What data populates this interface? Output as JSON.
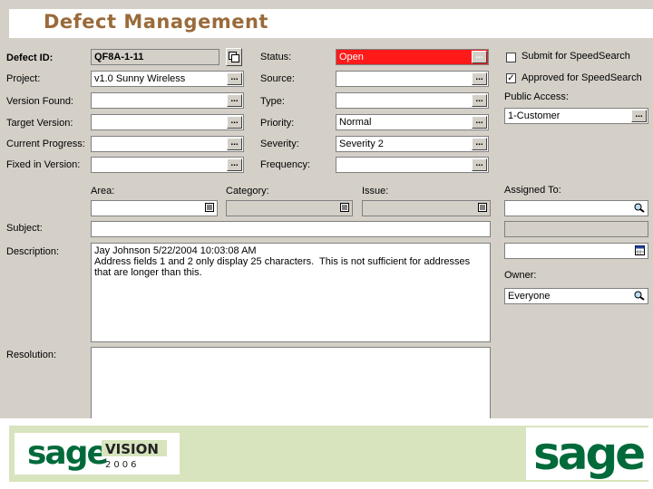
{
  "header": {
    "title": "Defect Management"
  },
  "fields": {
    "defect_id": {
      "label": "Defect ID:",
      "value": "QF8A-1-11"
    },
    "project": {
      "label": "Project:",
      "value": "v1.0 Sunny Wireless"
    },
    "version_found": {
      "label": "Version Found:",
      "value": ""
    },
    "target_version": {
      "label": "Target Version:",
      "value": ""
    },
    "current_progress": {
      "label": "Current Progress:",
      "value": ""
    },
    "fixed_in_version": {
      "label": "Fixed in Version:",
      "value": ""
    },
    "status": {
      "label": "Status:",
      "value": "Open"
    },
    "source": {
      "label": "Source:",
      "value": ""
    },
    "type": {
      "label": "Type:",
      "value": ""
    },
    "priority": {
      "label": "Priority:",
      "value": "Normal"
    },
    "severity": {
      "label": "Severity:",
      "value": "Severity 2"
    },
    "frequency": {
      "label": "Frequency:",
      "value": ""
    },
    "area": {
      "label": "Area:",
      "value": ""
    },
    "category": {
      "label": "Category:",
      "value": ""
    },
    "issue": {
      "label": "Issue:",
      "value": ""
    },
    "subject": {
      "label": "Subject:",
      "value": ""
    },
    "description": {
      "label": "Description:",
      "value": "Jay Johnson 5/22/2004 10:03:08 AM\nAddress fields 1 and 2 only display 25 characters.  This is not sufficient for addresses\nthat are longer than this."
    },
    "resolution": {
      "label": "Resolution:",
      "value": ""
    }
  },
  "right": {
    "submit_speedsearch": {
      "label": "Submit for SpeedSearch",
      "checked": false
    },
    "approved_speedsearch": {
      "label": "Approved for SpeedSearch",
      "checked": true,
      "mark": "✓"
    },
    "public_access": {
      "label": "Public Access:",
      "value": "1-Customer"
    },
    "assigned_to": {
      "label": "Assigned To:",
      "value": ""
    },
    "owner": {
      "label": "Owner:",
      "value": "Everyone"
    }
  },
  "footer": {
    "left_logo_brand": "sage",
    "left_logo_product": "VISION",
    "left_logo_year": "2006",
    "right_logo_brand": "sage"
  },
  "colors": {
    "status_open": "#ff1a1a",
    "brand_green": "#006a3a",
    "title_brown": "#9a6a3a",
    "footer_band": "#d7e4bd"
  }
}
